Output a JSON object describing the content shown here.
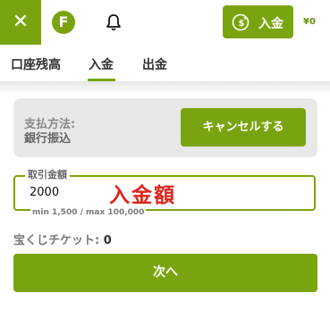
{
  "header": {
    "close_glyph": "✕",
    "logo_letter": "F",
    "deposit_button_label": "入金",
    "balance": "¥0",
    "brand_color": "#7aa40f",
    "icons": [
      "close-icon",
      "logo-icon",
      "bell-icon",
      "dollar-plus-icon"
    ]
  },
  "tabs": [
    {
      "label": "口座残高",
      "active": false
    },
    {
      "label": "入金",
      "active": true
    },
    {
      "label": "出金",
      "active": false
    }
  ],
  "payment": {
    "method_label": "支払方法:",
    "method_value": "銀行振込",
    "cancel_label": "キャンセルする"
  },
  "amount": {
    "legend": "取引金額",
    "value": "2000",
    "overlay_text": "入金額",
    "hint": "min 1,500 / max 100,000"
  },
  "lottery": {
    "label": "宝くじチケット:",
    "count": "0"
  },
  "next_button_label": "次へ"
}
